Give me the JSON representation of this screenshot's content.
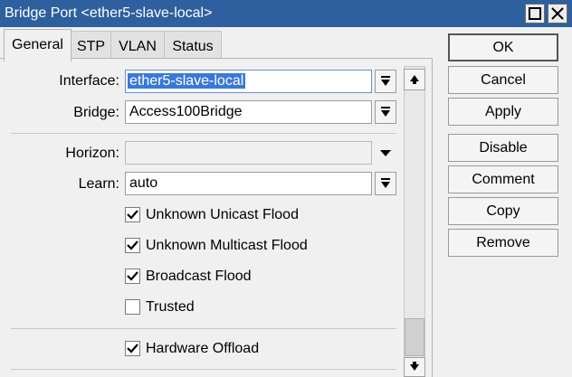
{
  "window": {
    "title": "Bridge Port <ether5-slave-local>"
  },
  "tabs": [
    {
      "label": "General",
      "active": true
    },
    {
      "label": "STP"
    },
    {
      "label": "VLAN"
    },
    {
      "label": "Status"
    }
  ],
  "form": {
    "interface": {
      "label": "Interface:",
      "value": "ether5-slave-local"
    },
    "bridge": {
      "label": "Bridge:",
      "value": "Access100Bridge"
    },
    "horizon": {
      "label": "Horizon:",
      "value": ""
    },
    "learn": {
      "label": "Learn:",
      "value": "auto"
    },
    "checkboxes": [
      {
        "label": "Unknown Unicast Flood",
        "checked": true
      },
      {
        "label": "Unknown Multicast Flood",
        "checked": true
      },
      {
        "label": "Broadcast Flood",
        "checked": true
      },
      {
        "label": "Trusted",
        "checked": false
      },
      {
        "label": "Hardware Offload",
        "checked": true
      }
    ]
  },
  "buttons": {
    "ok": "OK",
    "cancel": "Cancel",
    "apply": "Apply",
    "disable": "Disable",
    "comment": "Comment",
    "copy": "Copy",
    "remove": "Remove"
  },
  "icons": {
    "minimize": "minimize-icon",
    "close": "close-icon",
    "dropdown": "dropdown-arrow-icon",
    "scroll_up": "arrow-up-icon",
    "scroll_down": "arrow-down-icon",
    "check": "check-icon"
  },
  "colors": {
    "titlebar": "#2e5f9e",
    "selection": "#3a78d8",
    "window_bg": "#f0f0f0"
  }
}
